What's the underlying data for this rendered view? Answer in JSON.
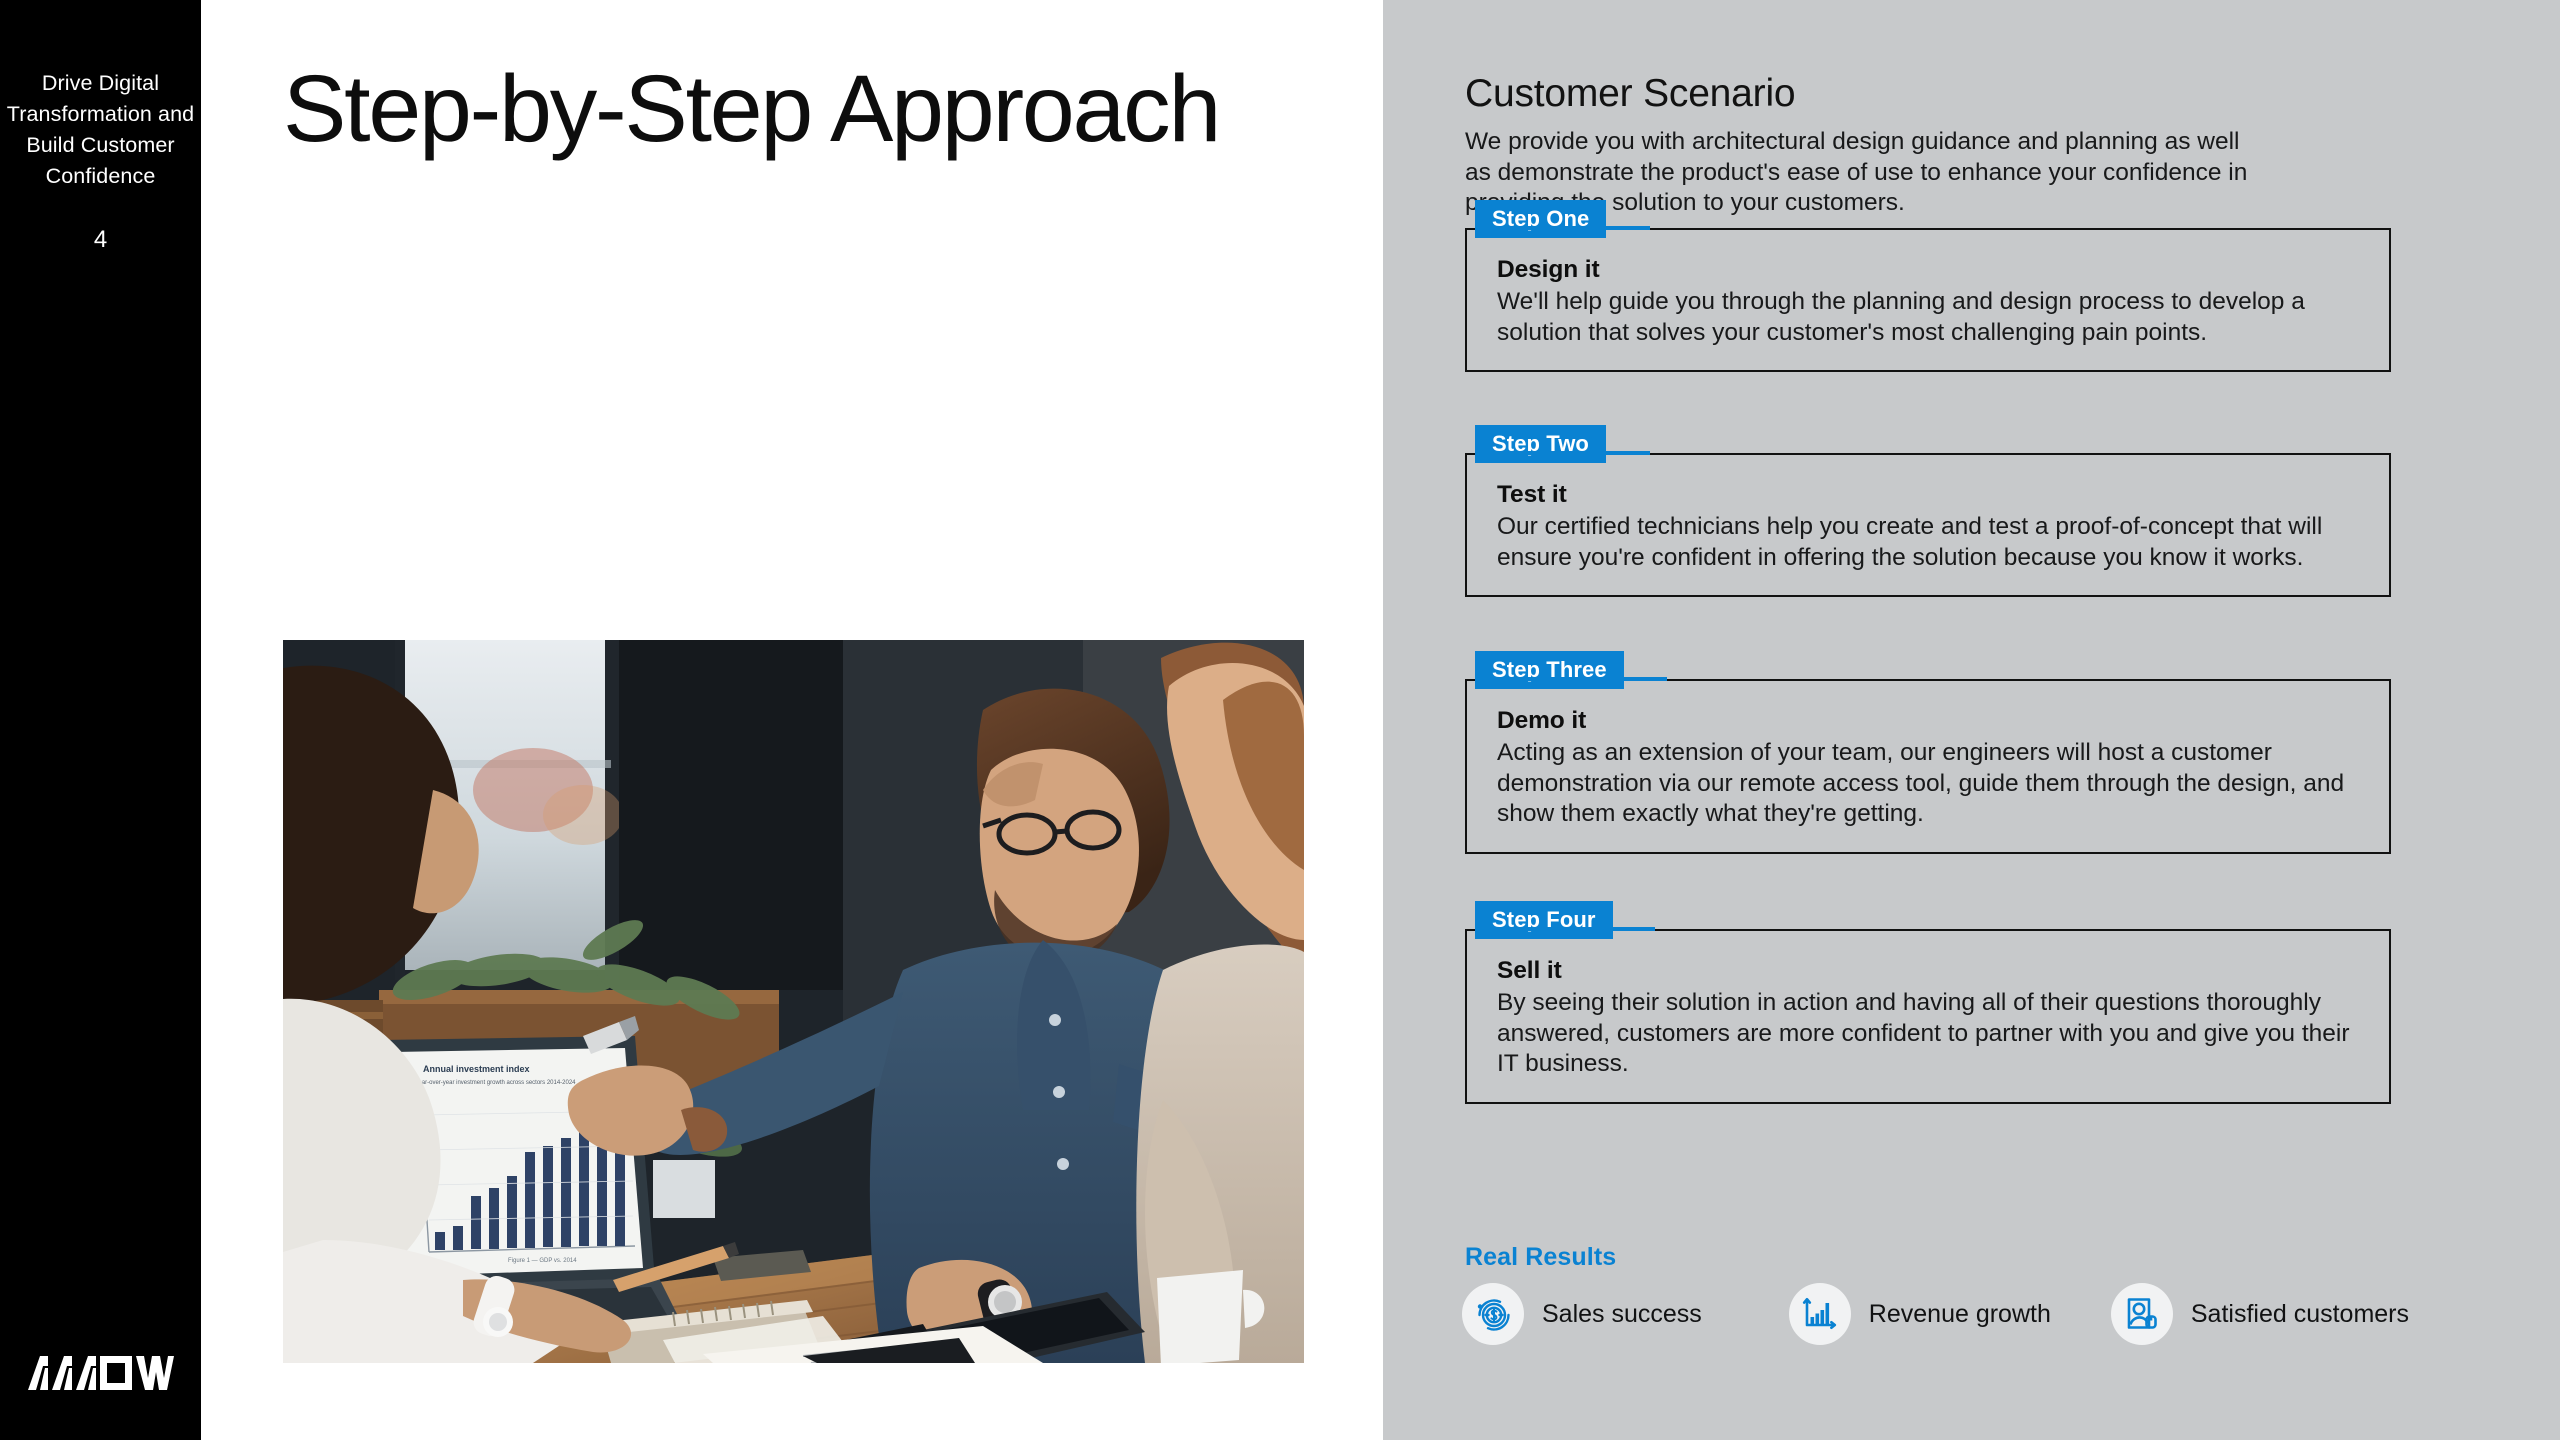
{
  "rail": {
    "title": "Drive Digital Transformation and Build Customer Confidence",
    "page_number": "4",
    "logo": "arrow-logo"
  },
  "center": {
    "headline": "Step-by-Step Approach",
    "photo_alt": "business-meeting-photo"
  },
  "right": {
    "section_title": "Customer Scenario",
    "intro": "We provide you with architectural design guidance and planning as well as demonstrate the product's ease of use to enhance your confidence in providing the solution to your customers.",
    "steps": [
      {
        "tab": "Step One",
        "heading": "Design it",
        "body": "We'll help guide you through the planning and design process to develop a solution that solves your customer's most challenging pain points."
      },
      {
        "tab": "Step Two",
        "heading": "Test it",
        "body": "Our certified technicians help you create and test a proof-of-concept that will ensure you're confident in offering the solution because you know it works."
      },
      {
        "tab": "Step Three",
        "heading": "Demo it",
        "body": "Acting as an extension of your team, our engineers will host a customer demonstration via our remote access tool, guide them through the design, and show them exactly what they're getting."
      },
      {
        "tab": "Step Four",
        "heading": "Sell it",
        "body": "By seeing their solution in action and having all of their questions thoroughly answered, customers are more confident to partner with you and give you their IT business."
      }
    ],
    "real_results": {
      "title": "Real Results",
      "items": [
        {
          "icon": "dollar-coin-refresh-icon",
          "label": "Sales success"
        },
        {
          "icon": "bar-chart-growth-icon",
          "label": "Revenue growth"
        },
        {
          "icon": "person-device-icon",
          "label": "Satisfied customers"
        }
      ]
    }
  },
  "colors": {
    "accent_blue": "#0a82d2",
    "rail_black": "#000000",
    "panel_gray": "#c7c9cb",
    "panel_white": "#ffffff",
    "badge_gray": "#f1f2f3"
  }
}
